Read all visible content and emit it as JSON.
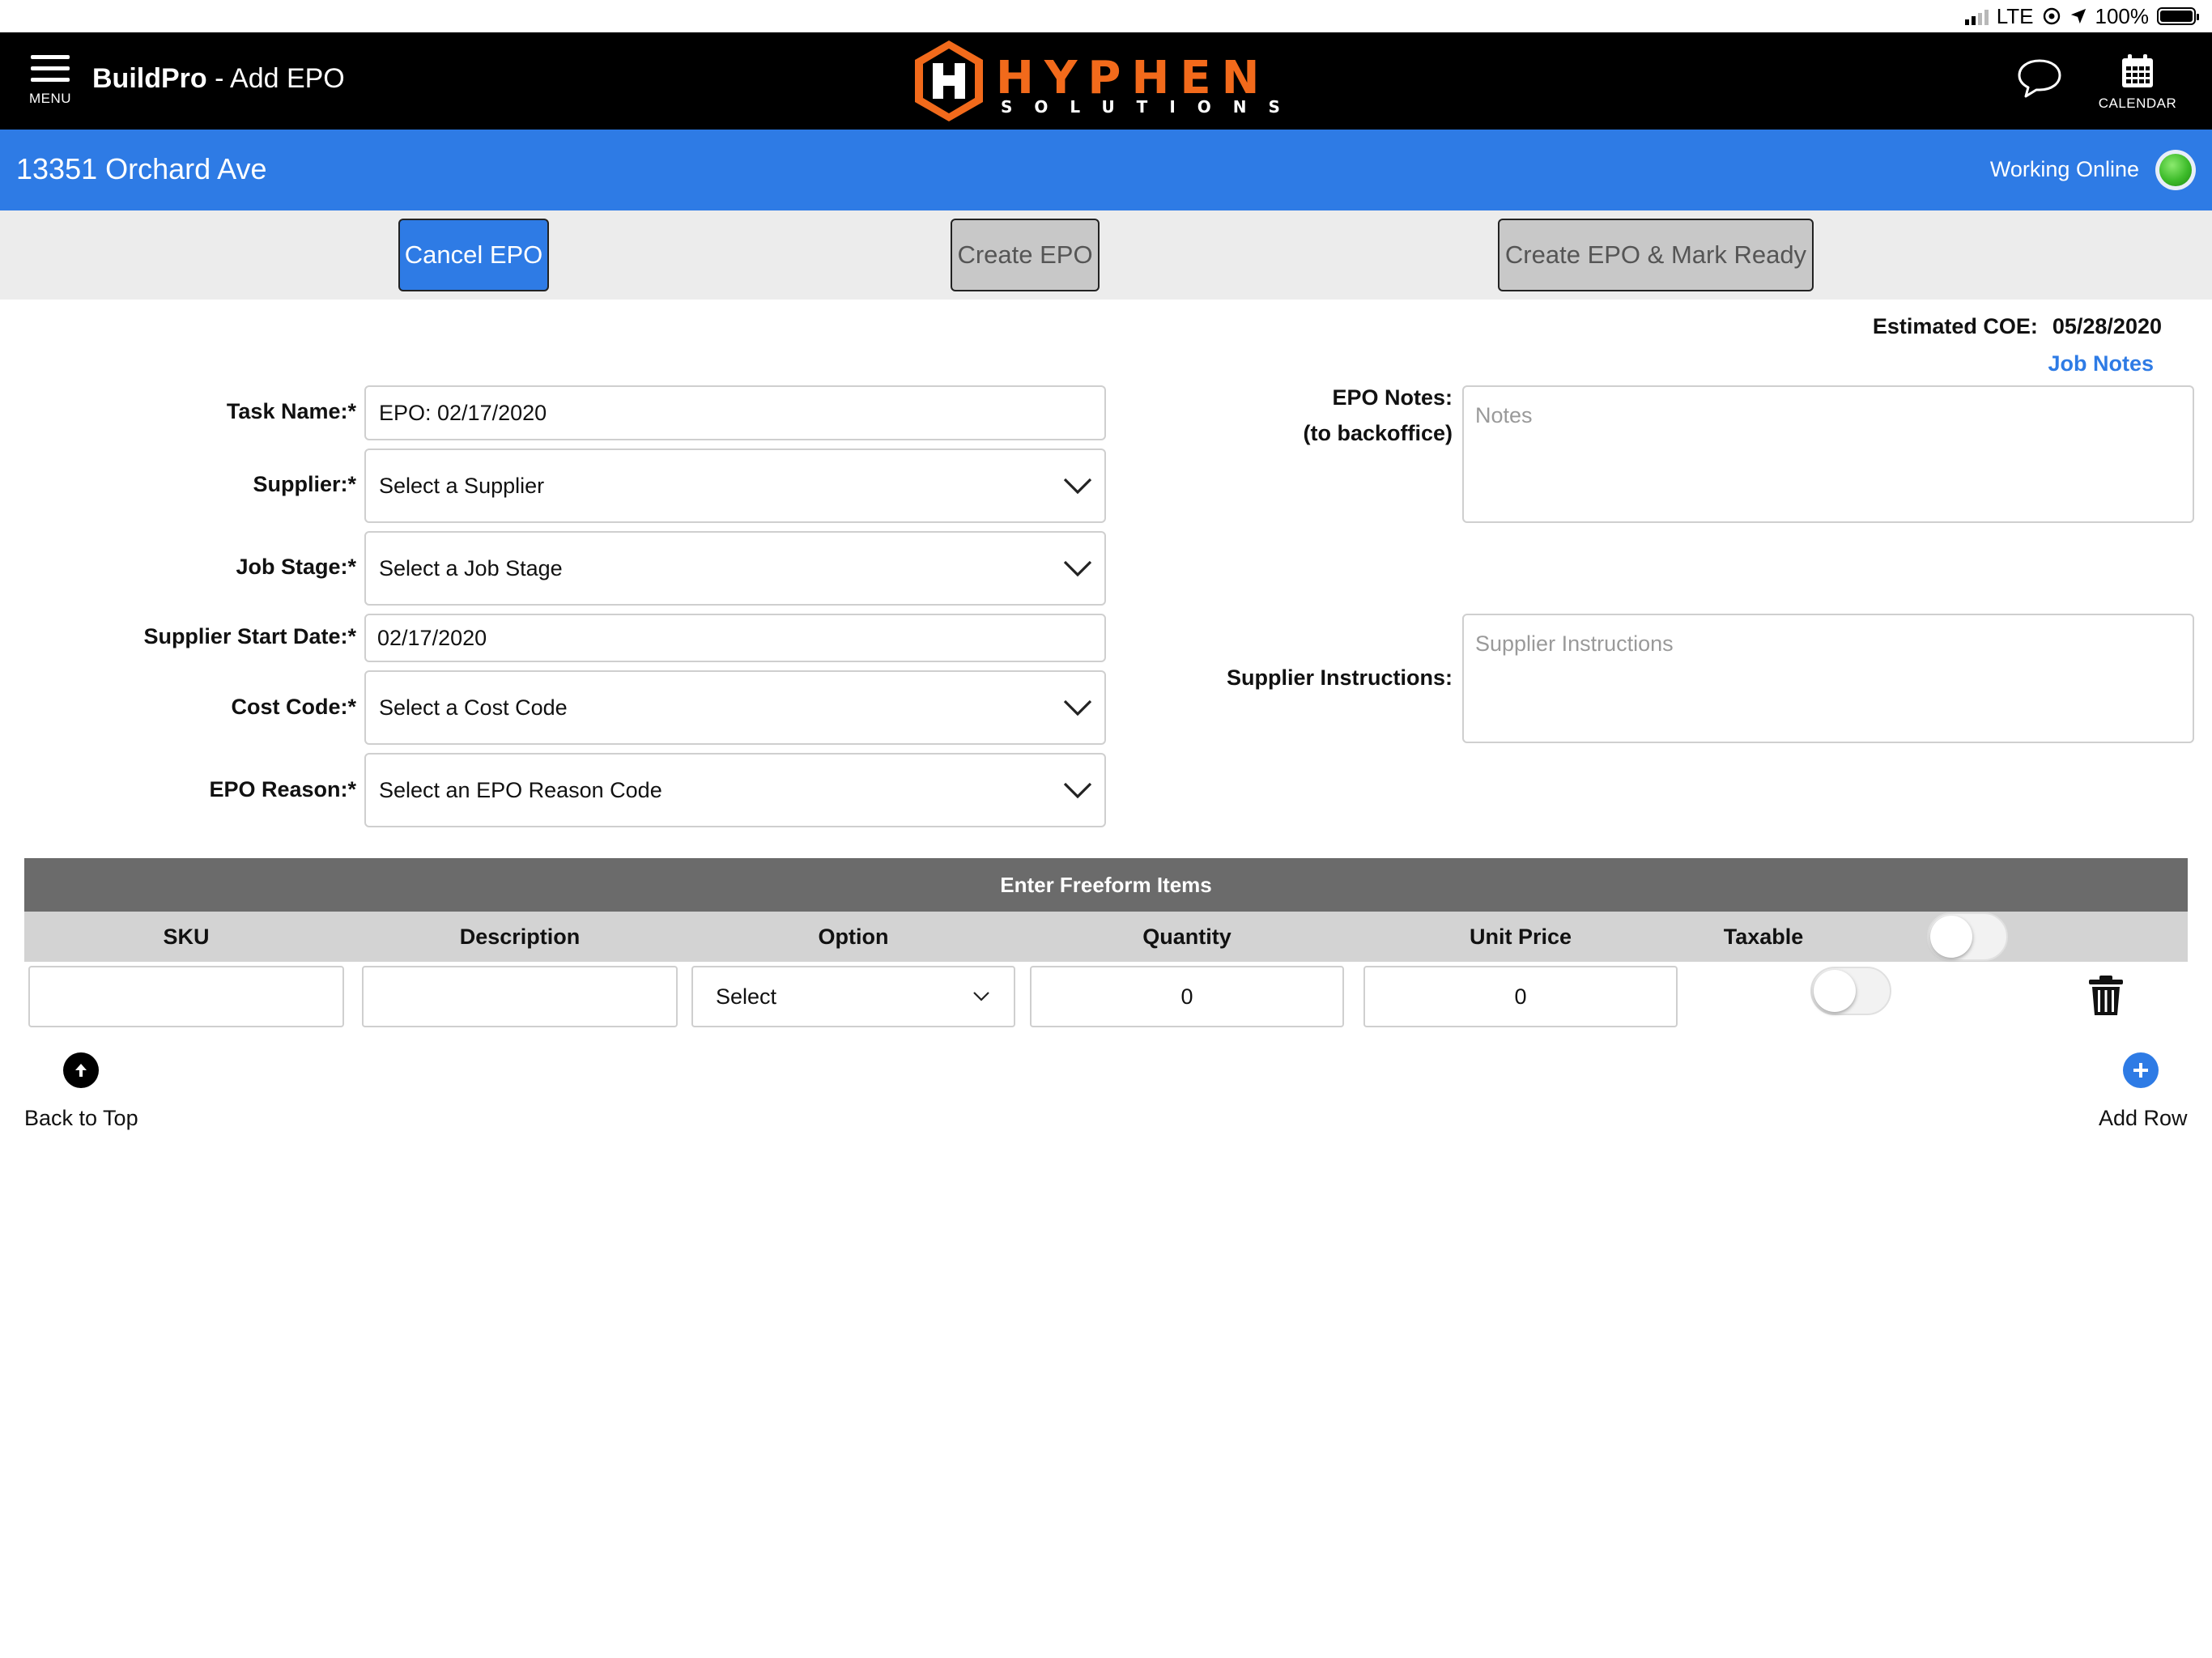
{
  "status_bar": {
    "network": "LTE",
    "battery": "100%"
  },
  "header": {
    "menu_label": "MENU",
    "app_name": "BuildPro",
    "page_name": " - Add EPO",
    "logo_word": "HYPHEN",
    "logo_sub": "SOLUTIONS",
    "calendar_label": "CALENDAR"
  },
  "address_bar": {
    "address": "13351 Orchard Ave",
    "status": "Working Online",
    "status_color": "#3dbb2a"
  },
  "actions": {
    "cancel": "Cancel EPO",
    "create": "Create EPO",
    "create_ready": "Create EPO & Mark Ready"
  },
  "coe": {
    "label": "Estimated COE:",
    "value": "05/28/2020",
    "job_notes": "Job Notes"
  },
  "form": {
    "task_name": {
      "label": "Task Name:*",
      "value": "EPO: 02/17/2020"
    },
    "supplier": {
      "label": "Supplier:*",
      "value": "Select a Supplier"
    },
    "job_stage": {
      "label": "Job Stage:*",
      "value": "Select a Job Stage"
    },
    "start_date": {
      "label": "Supplier Start Date:*",
      "value": "02/17/2020"
    },
    "cost_code": {
      "label": "Cost Code:*",
      "value": "Select a Cost Code"
    },
    "epo_reason": {
      "label": "EPO Reason:*",
      "value": "Select an EPO Reason Code"
    },
    "epo_notes": {
      "label": "EPO Notes:",
      "sublabel": "(to backoffice)",
      "placeholder": "Notes"
    },
    "supplier_instructions": {
      "label": "Supplier Instructions:",
      "placeholder": "Supplier Instructions"
    }
  },
  "freeform": {
    "title": "Enter Freeform Items",
    "columns": [
      "SKU",
      "Description",
      "Option",
      "Quantity",
      "Unit Price",
      "Taxable"
    ],
    "row": {
      "sku": "",
      "description": "",
      "option": "Select",
      "quantity": "0",
      "unit_price": "0",
      "taxable": false
    },
    "header_toggle": false
  },
  "footer": {
    "back_to_top": "Back to Top",
    "add_row": "Add Row"
  },
  "colors": {
    "brand_blue": "#2e7be5",
    "logo_orange": "#f26a1b",
    "header_black": "#000000"
  }
}
